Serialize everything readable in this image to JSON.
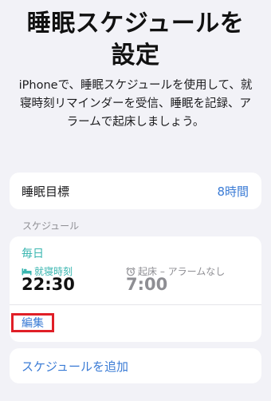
{
  "title": {
    "line1": "睡眠スケジュールを",
    "line2": "設定"
  },
  "description": {
    "line1": "iPhoneで、睡眠スケジュールを使用して、就",
    "line2": "寝時刻リマインダーを受信、睡眠を記録、ア",
    "line3": "ラームで起床しましょう。"
  },
  "sleep_goal": {
    "label": "睡眠目標",
    "value": "8時間"
  },
  "schedule_section": {
    "header": "スケジュール",
    "days": "毎日",
    "bedtime_label": "就寝時刻",
    "bedtime_value": "22:30",
    "wake_label": "起床 – アラームなし",
    "wake_value": "7:00",
    "edit_label": "編集",
    "bedtime_icon": "bed-icon",
    "wake_icon": "alarm-clock-icon"
  },
  "add_schedule": {
    "label": "スケジュールを追加"
  },
  "colors": {
    "accent_blue": "#3a7bd5",
    "teal": "#3ab6b0",
    "highlight_red": "#e01f27"
  }
}
